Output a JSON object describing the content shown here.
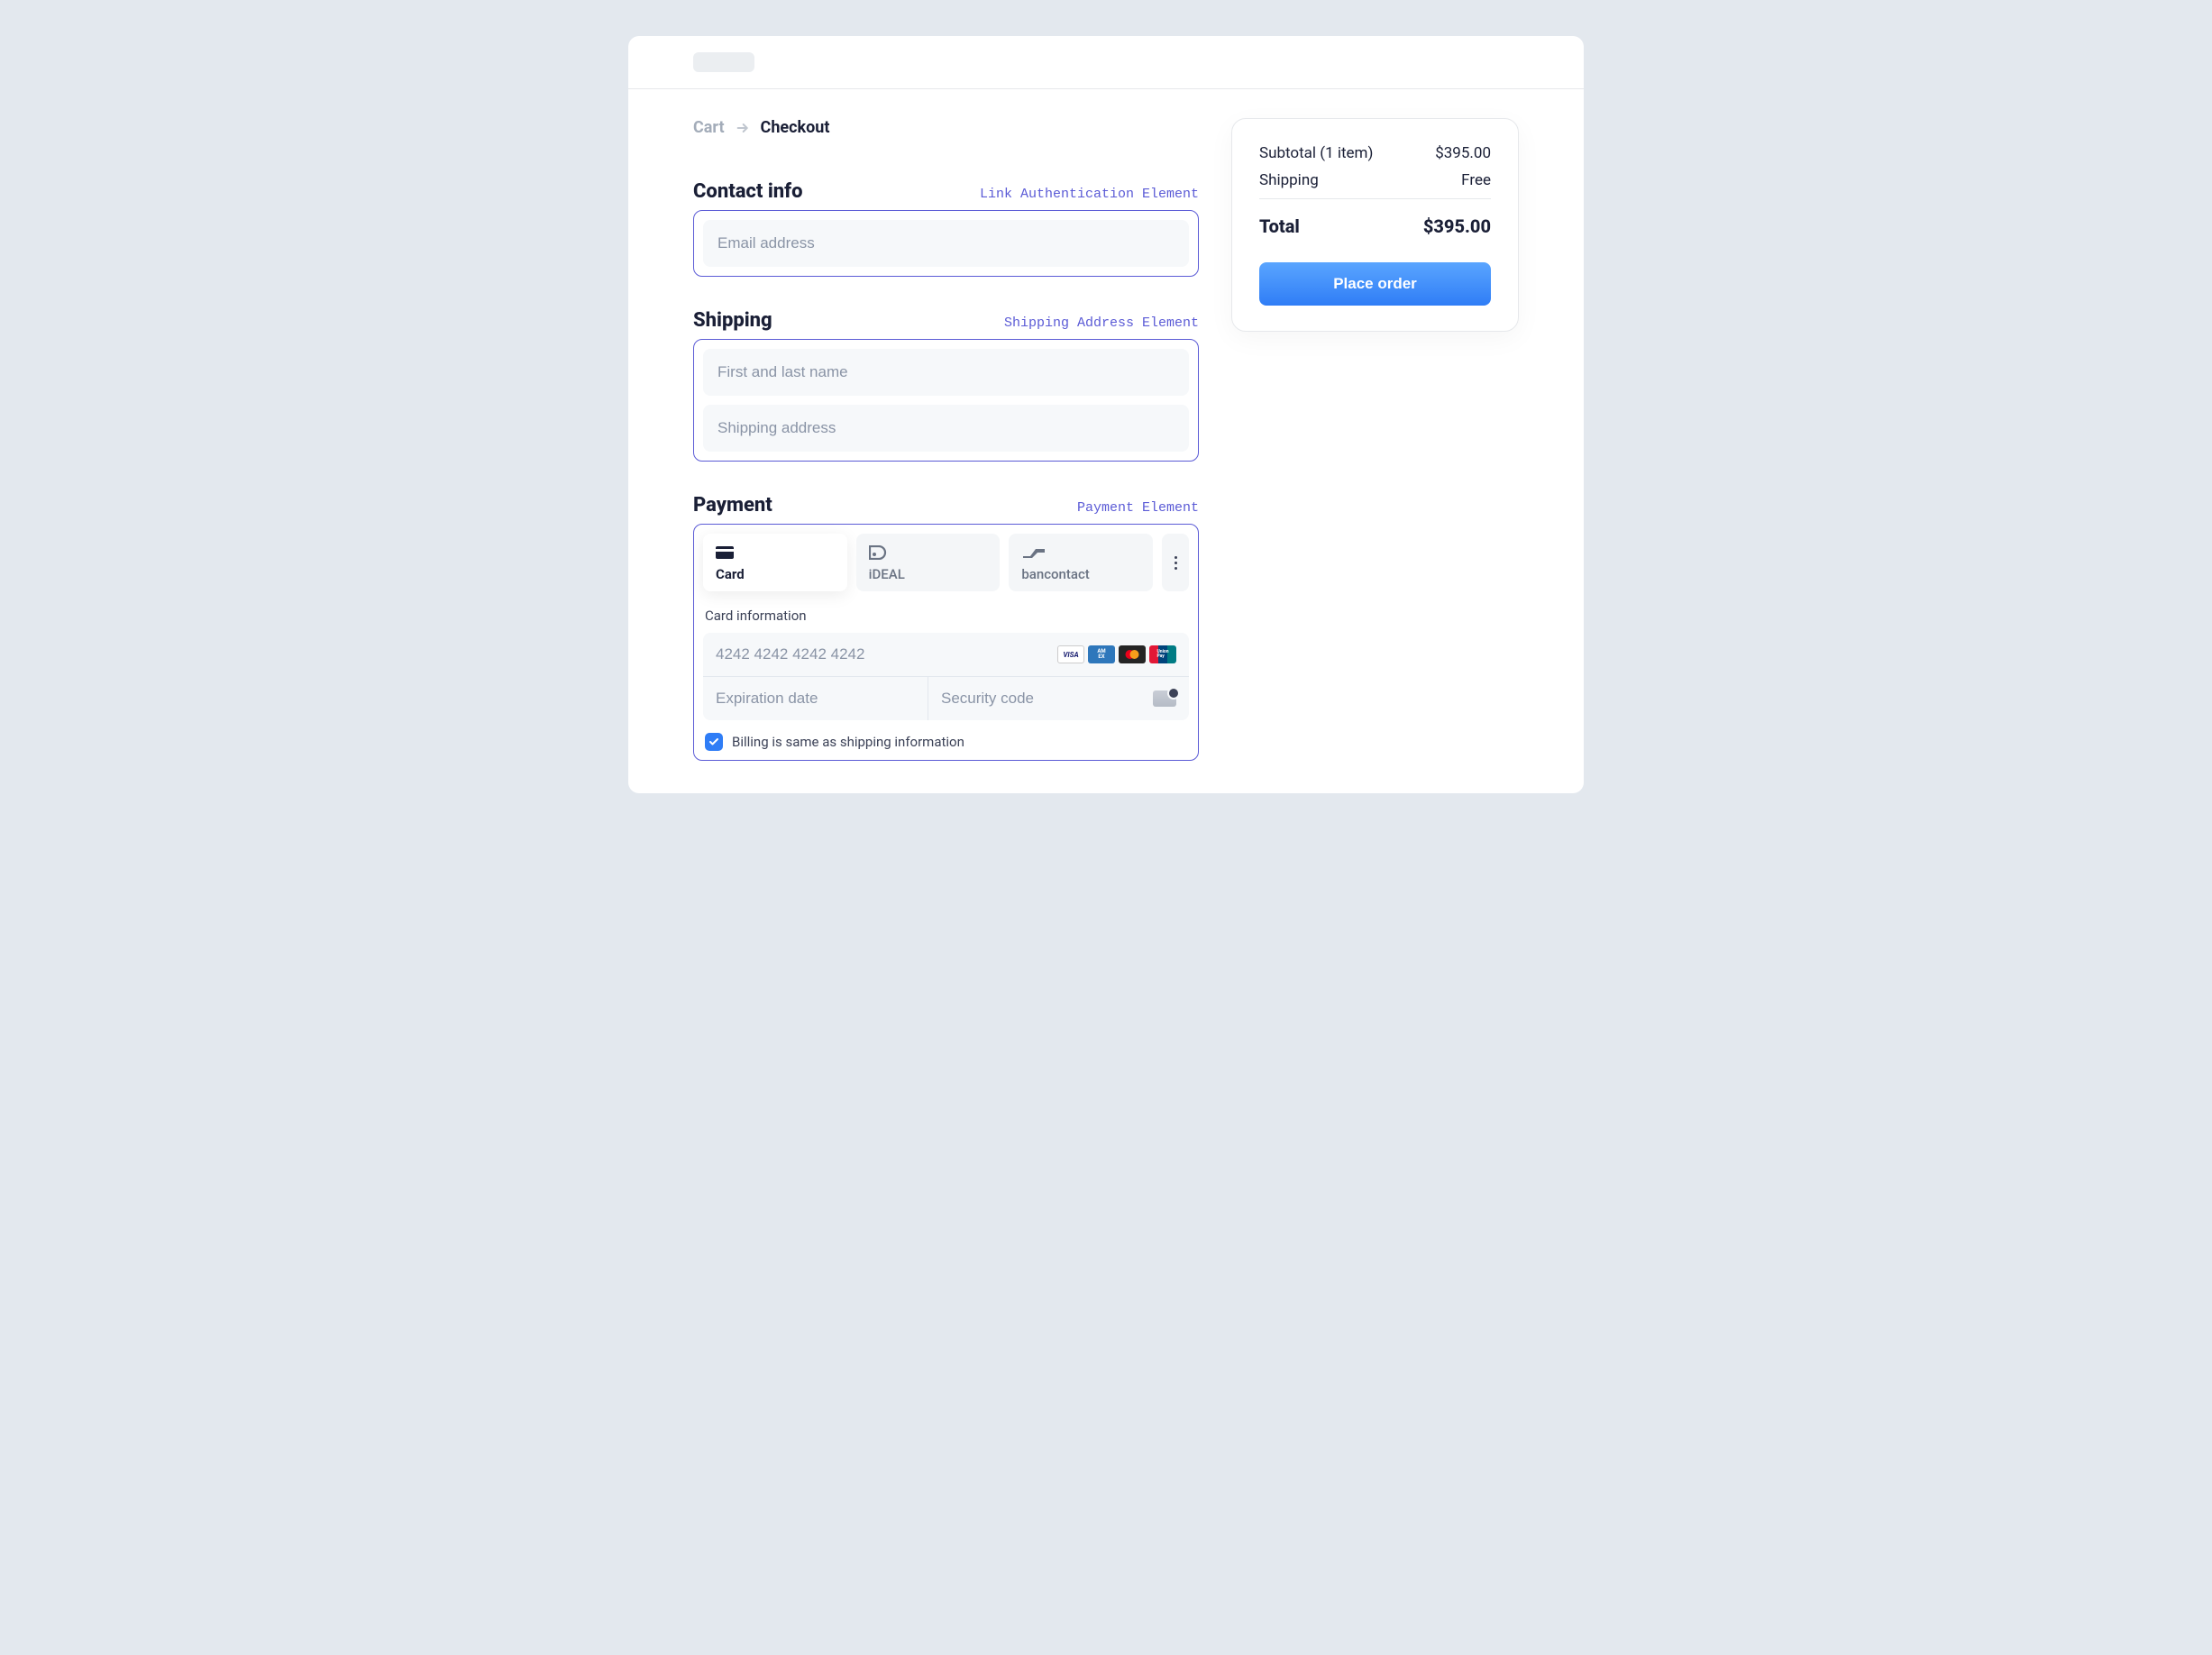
{
  "breadcrumb": {
    "cart": "Cart",
    "checkout": "Checkout"
  },
  "contact": {
    "title": "Contact info",
    "tag": "Link Authentication Element",
    "email_placeholder": "Email address"
  },
  "shipping": {
    "title": "Shipping",
    "tag": "Shipping Address Element",
    "name_placeholder": "First and last name",
    "address_placeholder": "Shipping address"
  },
  "payment": {
    "title": "Payment",
    "tag": "Payment Element",
    "methods": {
      "card": "Card",
      "ideal": "iDEAL",
      "bancontact": "bancontact"
    },
    "card_info_label": "Card information",
    "card_number_placeholder": "4242 4242 4242 4242",
    "expiration_placeholder": "Expiration date",
    "cvc_placeholder": "Security code",
    "billing_same_label": "Billing is same as shipping information"
  },
  "summary": {
    "subtotal_label": "Subtotal (1 item)",
    "subtotal_value": "$395.00",
    "shipping_label": "Shipping",
    "shipping_value": "Free",
    "total_label": "Total",
    "total_value": "$395.00",
    "cta": "Place order"
  }
}
